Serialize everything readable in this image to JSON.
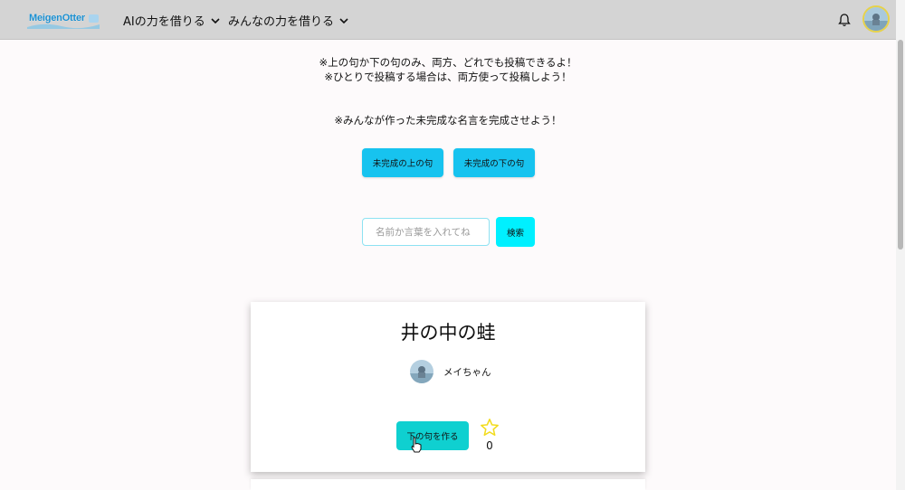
{
  "nav": {
    "logo_text": "MeigenOtter",
    "menu_ai": "AIの力を借りる",
    "menu_everyone": "みんなの力を借りる",
    "bell_icon": "bell-icon",
    "avatar_icon": "user-avatar"
  },
  "notices": {
    "line1": "※上の句か下の句のみ、両方、どれでも投稿できるよ！",
    "line2": "※ひとりで投稿する場合は、両方使って投稿しよう！",
    "line3": "※みんなが作った未完成な名言を完成させよう！"
  },
  "filters": {
    "upper_label": "未完成の上の句",
    "lower_label": "未完成の下の句"
  },
  "search": {
    "placeholder": "名前か言葉を入れてね",
    "value": "",
    "button_label": "検索"
  },
  "card": {
    "title": "井の中の蛙",
    "author": "メイちゃん",
    "make_button": "下の句を作る",
    "like_count": "0"
  },
  "colors": {
    "navbar": "#d4d4d4",
    "filter_button": "#17c3ef",
    "search_button": "#00f0ff",
    "make_button": "#0fd0d0",
    "star": "#f2dc1e"
  }
}
